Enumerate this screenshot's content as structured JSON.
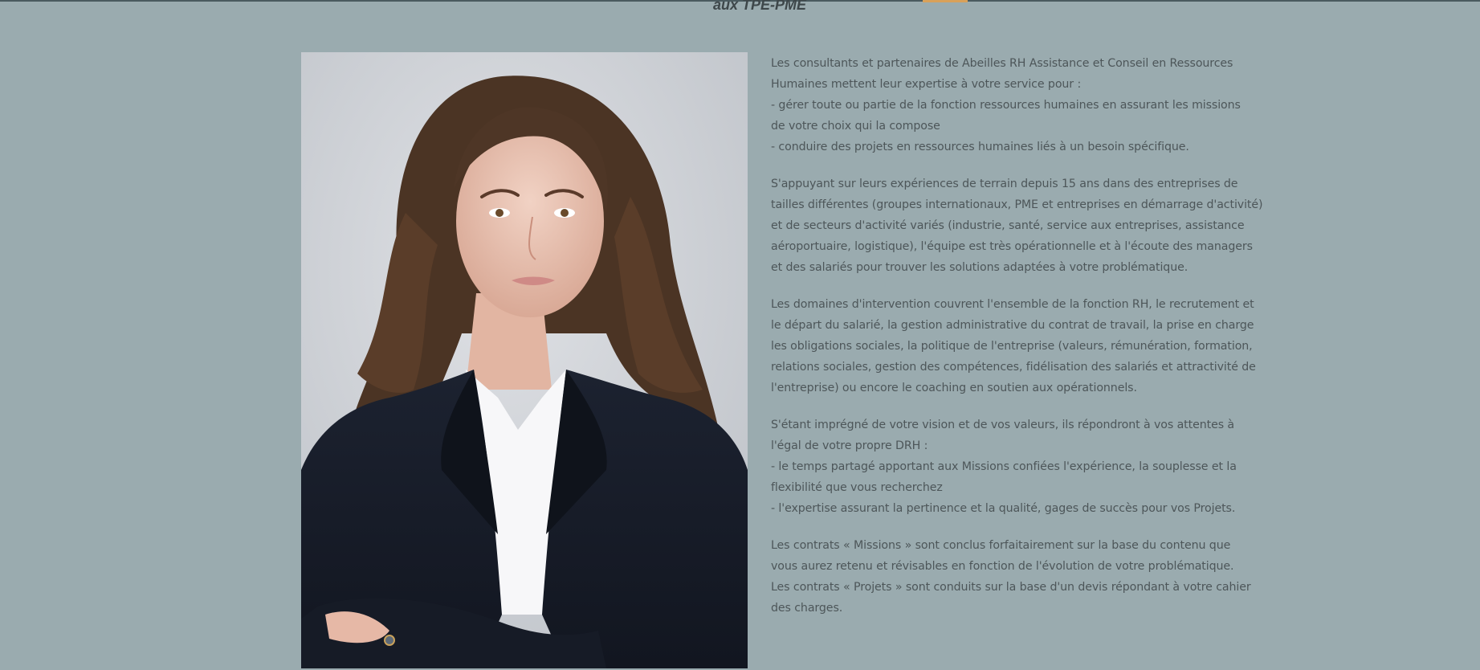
{
  "header": {
    "tagline": "aux TPE-PME",
    "accent_color": "#d8a15a"
  },
  "portrait": {
    "icon": "portrait-photo"
  },
  "content": {
    "paragraphs": [
      {
        "lines": [
          "Les consultants et partenaires de Abeilles RH Assistance et Conseil en Ressources",
          "Humaines mettent leur expertise à votre service pour :",
          "- gérer toute ou partie de la fonction ressources humaines en assurant les missions",
          "de votre choix qui la compose",
          "- conduire des projets en ressources humaines liés à un besoin spécifique."
        ]
      },
      {
        "lines": [
          "S'appuyant sur leurs expériences de terrain depuis 15 ans dans des entreprises de",
          "tailles différentes (groupes internationaux, PME et entreprises en démarrage d'activité)",
          "et de secteurs d'activité variés (industrie, santé, service aux entreprises, assistance",
          "aéroportuaire, logistique), l'équipe est très opérationnelle et à l'écoute des managers",
          "et des salariés pour trouver les solutions adaptées à votre problématique."
        ]
      },
      {
        "lines": [
          "Les domaines d'intervention couvrent l'ensemble de la fonction RH, le recrutement et",
          "le départ du salarié, la gestion administrative du contrat de travail, la prise en charge",
          "les obligations sociales, la politique de l'entreprise (valeurs, rémunération, formation,",
          "relations sociales, gestion des compétences, fidélisation des salariés et attractivité de",
          "l'entreprise) ou encore le coaching en soutien aux opérationnels."
        ]
      },
      {
        "lines": [
          "S'étant imprégné de votre vision et de vos valeurs, ils répondront à vos attentes à",
          "l'égal de votre propre DRH :",
          "- le temps partagé apportant aux Missions confiées l'expérience, la souplesse et la",
          "flexibilité que vous recherchez",
          "- l'expertise assurant la pertinence et la qualité, gages de succès pour vos Projets."
        ]
      },
      {
        "lines": [
          "Les contrats « Missions » sont conclus forfaitairement sur la base du contenu que",
          "vous aurez retenu et révisables en fonction de l'évolution de votre problématique.",
          "Les contrats « Projets » sont conduits sur la base d'un devis répondant à votre cahier",
          "des charges."
        ]
      }
    ]
  }
}
